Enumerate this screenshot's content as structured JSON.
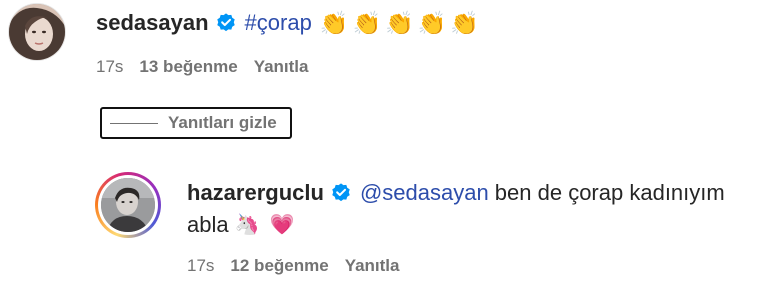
{
  "comments": [
    {
      "username": "sedasayan",
      "hashtag": "#çorap",
      "emojis": [
        "👏",
        "👏",
        "👏",
        "👏",
        "👏"
      ],
      "time": "17s",
      "likes": "13 beğenme",
      "reply": "Yanıtla"
    },
    {
      "username": "hazarerguclu",
      "mention": "@sedasayan",
      "text_line1": " ben de çorap kadınıyım",
      "text_line2": "abla",
      "emoji_unicorn": "🦄",
      "emoji_heart": "💗",
      "time": "17s",
      "likes": "12 beğenme",
      "reply": "Yanıtla"
    }
  ],
  "hide_replies_label": "Yanıtları gizle",
  "colors": {
    "text": "#262626",
    "secondary": "#737373",
    "link": "#2d4dab",
    "verified": "#0095f6"
  }
}
